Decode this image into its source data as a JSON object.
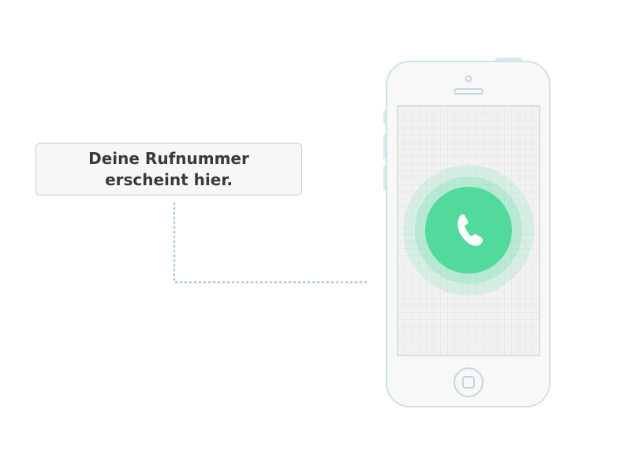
{
  "callout": {
    "text": "Deine Rufnummer erscheint hier."
  },
  "phone": {
    "call_icon": "phone-handset-icon",
    "accent_color": "#4cd99a",
    "outline_color": "#cfe3e6"
  }
}
